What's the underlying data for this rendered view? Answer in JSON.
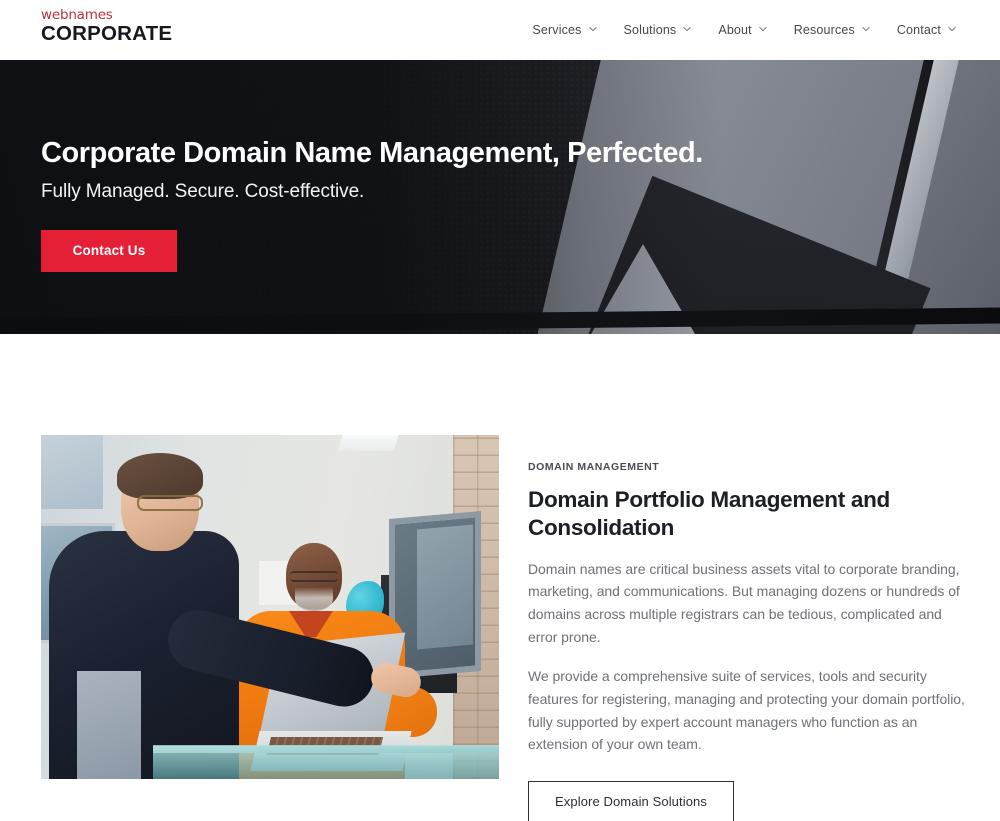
{
  "header": {
    "logo": {
      "line1": "webnames",
      "line2": "CORPORATE",
      "line1_color": "#b8323f",
      "line2_color": "#17191c"
    },
    "nav": [
      {
        "label": "Services",
        "icon": "chevron-down-icon"
      },
      {
        "label": "Solutions",
        "icon": "chevron-down-icon"
      },
      {
        "label": "About",
        "icon": "chevron-down-icon"
      },
      {
        "label": "Resources",
        "icon": "chevron-down-icon"
      },
      {
        "label": "Contact",
        "icon": "chevron-down-icon"
      }
    ]
  },
  "hero": {
    "title": "Corporate Domain Name Management, Perfected.",
    "subtitle": "Fully Managed. Secure. Cost-effective.",
    "cta_label": "Contact Us",
    "cta_color": "#e51f35",
    "background_description": "Dark perforated architectural ceiling panels with angled grey planes"
  },
  "feature": {
    "eyebrow": "DOMAIN MANAGEMENT",
    "title": "Domain Portfolio Management and Consolidation",
    "paragraph1": "Domain names are critical business assets vital to corporate branding, marketing, and communications. But managing dozens or hundreds of domains across multiple registrars can be tedious, complicated and error prone.",
    "paragraph2": "We provide a comprehensive suite of services, tools and security features for registering, managing and protecting your domain portfolio, fully supported by expert account managers who function as an extension of your own team.",
    "button_label": "Explore Domain Solutions",
    "image_description": "Two men in an office, one in a dark blazer pointing at a laptop on a glass desk, the other in an orange shirt smiling"
  }
}
